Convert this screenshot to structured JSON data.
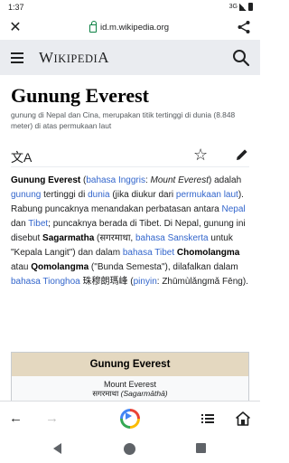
{
  "status_bar": {
    "time": "1:37",
    "network": "3G"
  },
  "browser": {
    "url": "id.m.wikipedia.org"
  },
  "wiki_header": {
    "wordmark_first": "W",
    "wordmark_mid": "IKIPEDI",
    "wordmark_last": "A"
  },
  "article": {
    "title": "Gunung Everest",
    "description": "gunung di Nepal dan Cina, merupakan titik tertinggi di dunia (8.848 meter) di atas permukaan laut",
    "p": {
      "t1": "Gunung Everest",
      "t2": " (",
      "l1": "bahasa Inggris",
      "t3": ": ",
      "i1": "Mount Everest",
      "t4": ") adalah ",
      "l2": "gunung",
      "t5": " tertinggi di ",
      "l3": "dunia",
      "t6": " (jika diukur dari ",
      "l4": "permukaan laut",
      "t7": "). Rabung puncaknya menandakan perbatasan antara ",
      "l5": "Nepal",
      "t8": " dan ",
      "l6": "Tibet",
      "t9": "; puncaknya berada di Tibet. Di Nepal, gunung ini disebut ",
      "b2": "Sagarmatha",
      "t10": " (सगरमाथा, ",
      "l7": "bahasa Sanskerta",
      "t11": " untuk \"Kepala Langit\") dan dalam ",
      "l8": "bahasa Tibet",
      "t12": " ",
      "b3": "Chomolangma",
      "t13": " atau ",
      "b4": "Qomolangma",
      "t14": " (\"Bunda Semesta\"), dilafalkan dalam ",
      "l9": "bahasa Tionghoa",
      "t15": " 珠穆朗瑪峰 (",
      "l10": "pinyin",
      "t16": ": Zhūmùlǎngmǎ Fēng)."
    },
    "infobox": {
      "title": "Gunung Everest",
      "name": "Mount Everest",
      "native_script": "सगरमाथा ",
      "native_latin": "(Sagarmāthā)"
    }
  },
  "icons": {
    "close": "close-icon",
    "lock": "lock-icon",
    "share": "share-icon",
    "menu": "menu-icon",
    "search": "search-icon",
    "language": "language-icon",
    "star": "star-icon",
    "edit": "pencil-icon",
    "back": "arrow-left-icon",
    "forward": "arrow-right-icon",
    "assistant": "assistant-icon",
    "toc": "table-of-contents-icon",
    "home": "home-icon"
  },
  "colors": {
    "link": "#3366cc",
    "header_bg": "#eaecf0",
    "infobox_title_bg": "#e4d8c0",
    "secure_lock": "#0b8043"
  }
}
